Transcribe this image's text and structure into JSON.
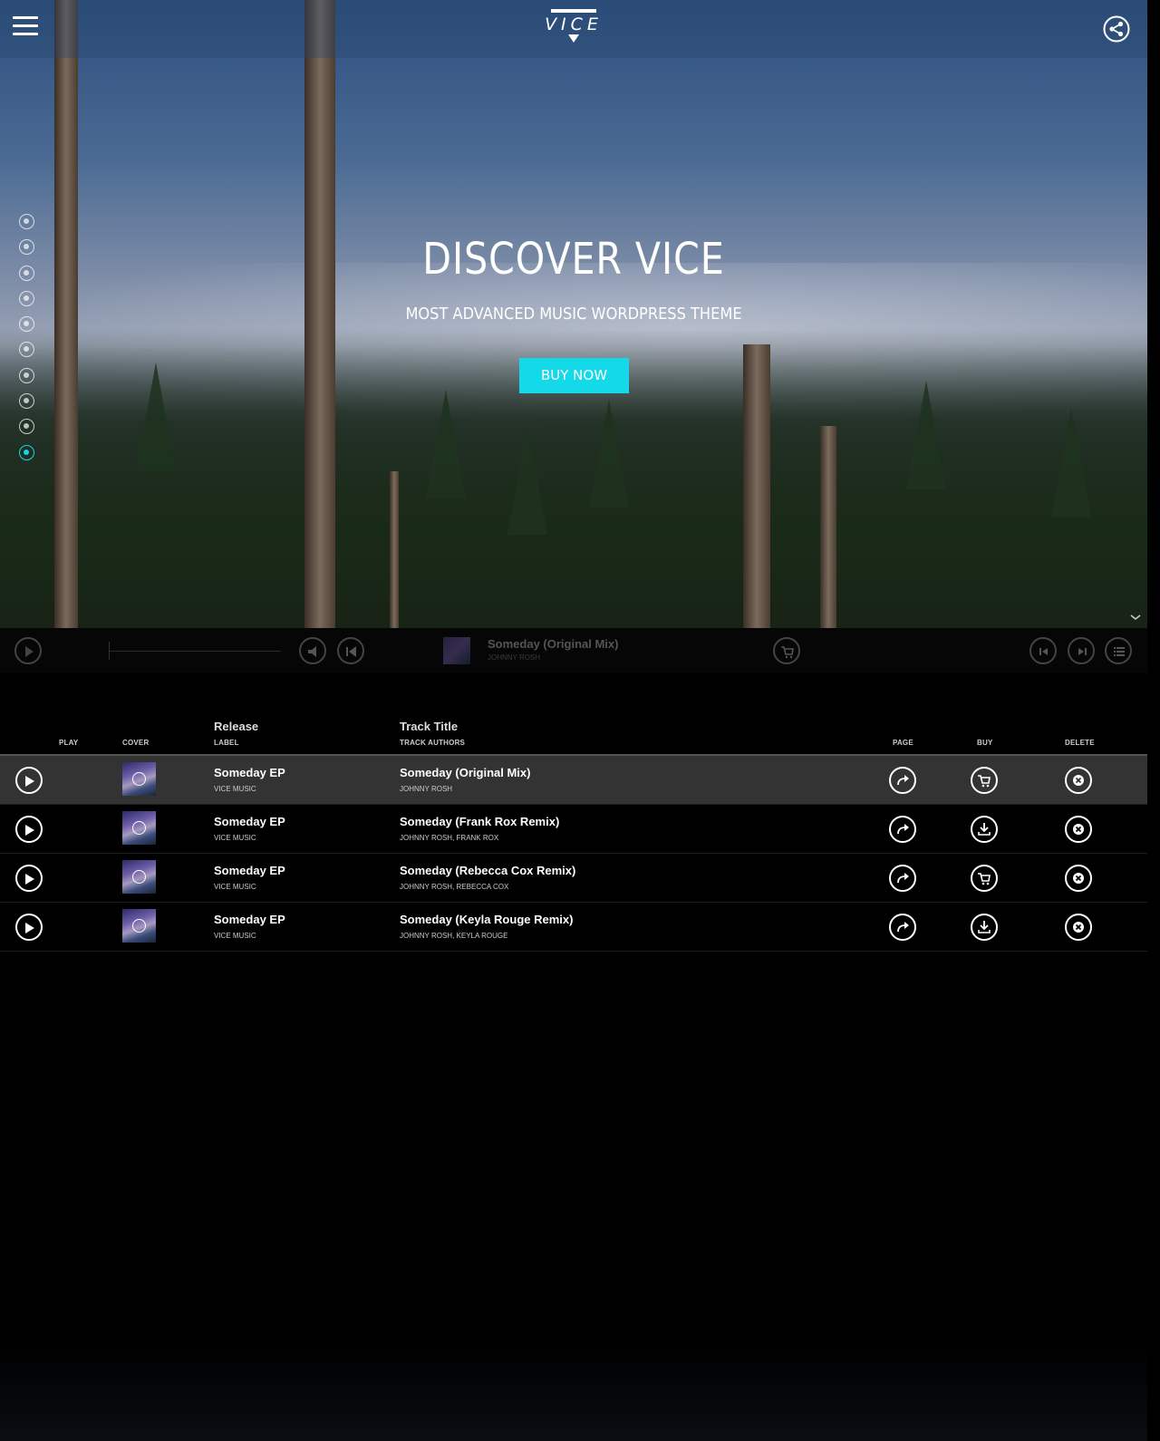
{
  "header": {
    "logo_text": "VICE",
    "menu_icon": "hamburger-menu-icon",
    "share_icon": "share-icon"
  },
  "side_nav": {
    "items": [
      {
        "icon": "facebook-icon"
      },
      {
        "icon": "headphones-icon"
      },
      {
        "icon": "star-icon"
      },
      {
        "icon": "cocktail-icon"
      },
      {
        "icon": "photo-icon"
      },
      {
        "icon": "award-icon"
      },
      {
        "icon": "camera-icon"
      },
      {
        "icon": "list-icon"
      },
      {
        "icon": "pen-icon"
      },
      {
        "icon": "record-icon",
        "active": true
      }
    ],
    "accent": "#19d3e6"
  },
  "hero": {
    "title": "DISCOVER VICE",
    "subtitle": "MOST ADVANCED MUSIC WORDPRESS THEME",
    "cta_label": "BUY NOW",
    "cta_color": "#14d9e8"
  },
  "player": {
    "now_playing_title": "Someday (Original Mix)",
    "now_playing_artist": "JOHNNY ROSH"
  },
  "tracklist": {
    "headers": {
      "play": "PLAY",
      "cover": "COVER",
      "release": "Release",
      "label": "LABEL",
      "track_title": "Track Title",
      "track_authors": "TRACK AUTHORS",
      "page": "PAGE",
      "buy": "BUY",
      "delete": "DELETE"
    },
    "rows": [
      {
        "release": "Someday EP",
        "label": "VICE MUSIC",
        "title": "Someday (Original Mix)",
        "authors": "JOHNNY ROSH",
        "buy_icon": "cart-icon",
        "active": true
      },
      {
        "release": "Someday EP",
        "label": "VICE MUSIC",
        "title": "Someday (Frank Rox Remix)",
        "authors": "JOHNNY ROSH, FRANK ROX",
        "buy_icon": "download-icon",
        "active": false
      },
      {
        "release": "Someday EP",
        "label": "VICE MUSIC",
        "title": "Someday (Rebecca Cox Remix)",
        "authors": "JOHNNY ROSH, REBECCA COX",
        "buy_icon": "cart-icon",
        "active": false
      },
      {
        "release": "Someday EP",
        "label": "VICE MUSIC",
        "title": "Someday (Keyla Rouge Remix)",
        "authors": "JOHNNY ROSH, KEYLA ROUGE",
        "buy_icon": "download-icon",
        "active": false
      }
    ]
  }
}
